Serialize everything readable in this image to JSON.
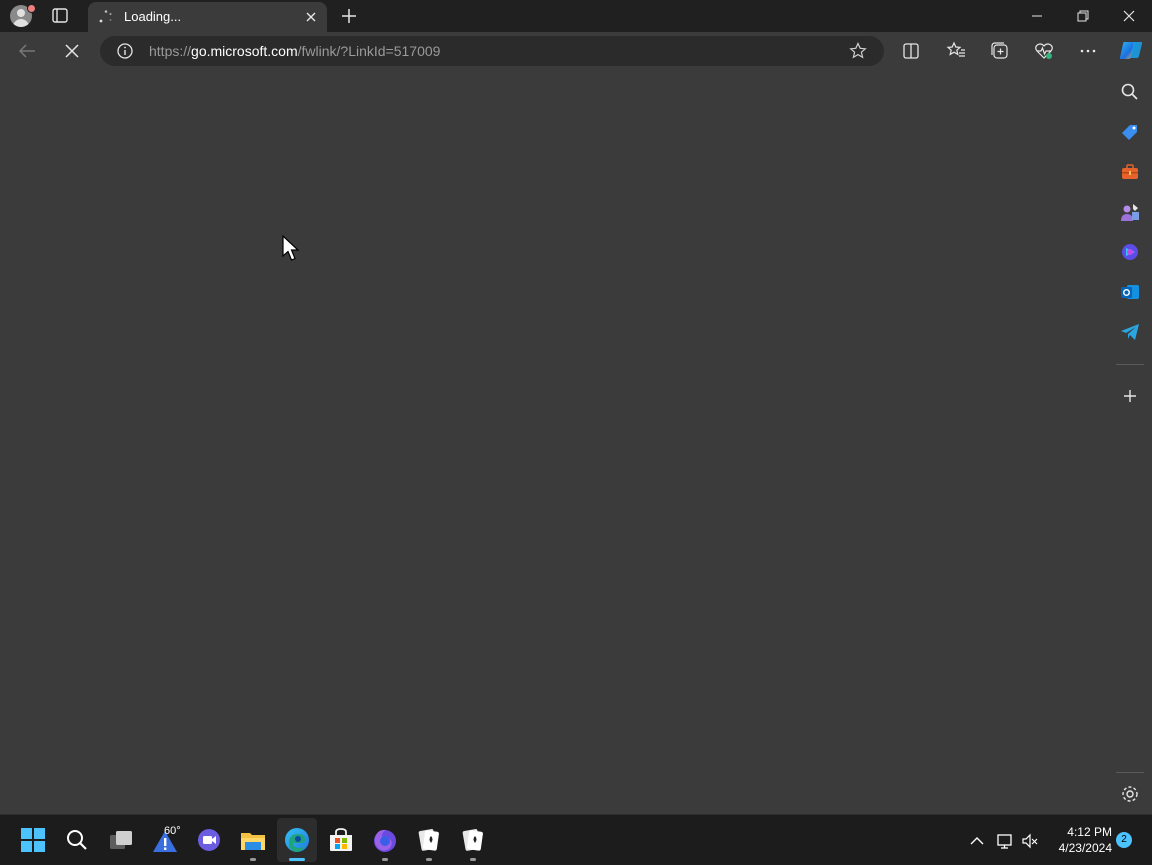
{
  "browser": {
    "tab": {
      "title": "Loading..."
    },
    "address_bar": {
      "url_prefix": "https://",
      "url_host": "go.microsoft.com",
      "url_path": "/fwlink/?LinkId=517009"
    },
    "sidebar_icons": [
      "search-icon",
      "shopping-tag-icon",
      "tools-icon",
      "games-icon",
      "copilot-icon",
      "outlook-icon",
      "telegram-icon",
      "add-icon",
      "settings-icon"
    ]
  },
  "taskbar": {
    "weather": {
      "temp": "60°"
    },
    "clock": {
      "time": "4:12 PM",
      "date": "4/23/2024"
    },
    "notification_count": "2"
  },
  "colors": {
    "content_bg": "#3b3b3b",
    "titlebar_bg": "#202020",
    "taskbar_bg": "#1c1c1c",
    "accent": "#4cc2ff"
  }
}
